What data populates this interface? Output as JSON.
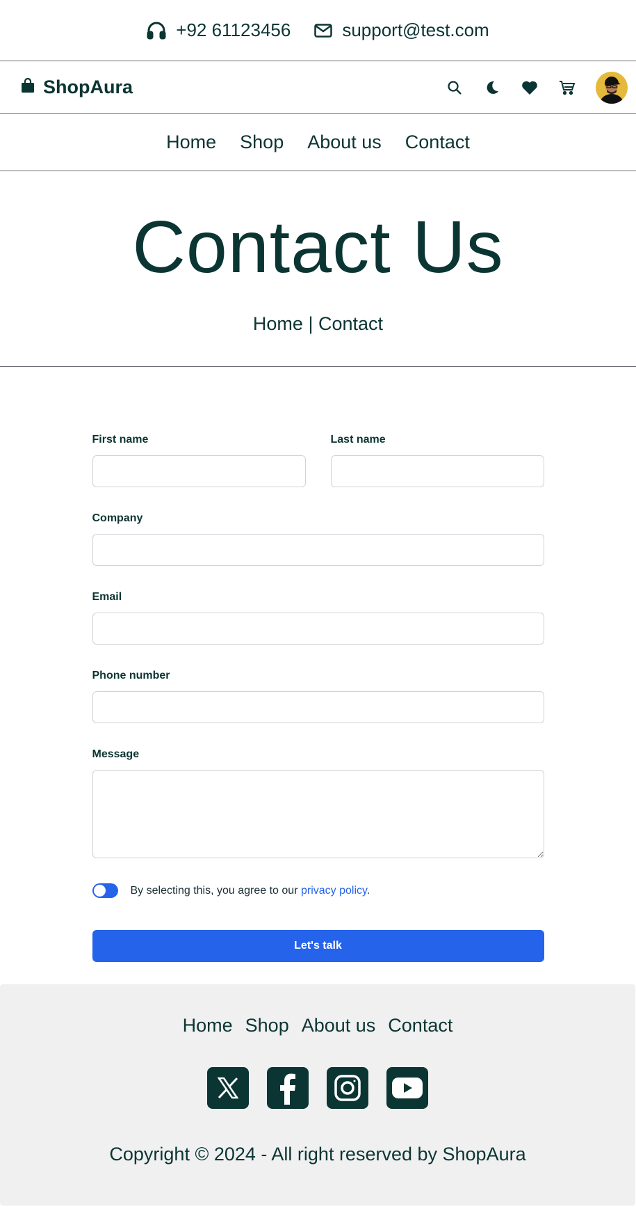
{
  "topbar": {
    "phone": "+92 61123456",
    "email": "support@test.com",
    "phone_icon": "headphones-icon",
    "email_icon": "envelope-icon"
  },
  "header": {
    "brand": "ShopAura",
    "brand_icon": "shopping-bag-icon",
    "actions": [
      "search-icon",
      "moon-icon",
      "heart-icon",
      "cart-icon",
      "avatar"
    ]
  },
  "nav": {
    "items": [
      "Home",
      "Shop",
      "About us",
      "Contact"
    ]
  },
  "hero": {
    "title": "Contact Us",
    "breadcrumb_home": "Home",
    "breadcrumb_sep": "|",
    "breadcrumb_current": "Contact"
  },
  "form": {
    "first_name_label": "First name",
    "last_name_label": "Last name",
    "company_label": "Company",
    "email_label": "Email",
    "phone_label": "Phone number",
    "message_label": "Message",
    "agree_text": "By selecting this, you agree to our ",
    "agree_link": "privacy policy",
    "agree_end": ".",
    "submit_label": "Let's talk",
    "values": {
      "first_name": "",
      "last_name": "",
      "company": "",
      "email": "",
      "phone": "",
      "message": ""
    }
  },
  "footer": {
    "nav": [
      "Home",
      "Shop",
      "About us",
      "Contact"
    ],
    "socials": [
      "x-icon",
      "facebook-icon",
      "instagram-icon",
      "youtube-icon"
    ],
    "copyright": "Copyright © 2024 - All right reserved by ShopAura"
  },
  "colors": {
    "primary_text": "#0b3533",
    "accent": "#2563eb",
    "footer_bg": "#f0f0f0",
    "border": "#6b6f75"
  }
}
